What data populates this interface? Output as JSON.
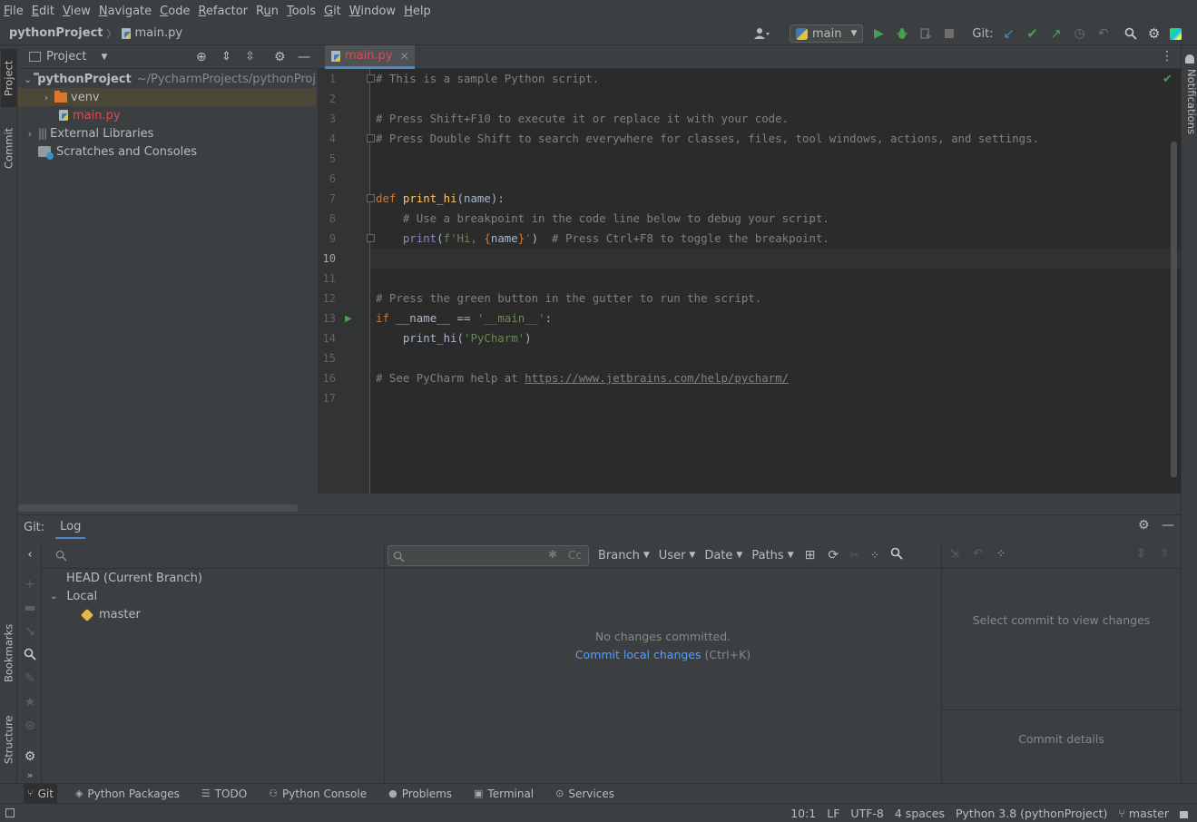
{
  "menu": {
    "items": [
      {
        "label": "File",
        "mnemonic": "F"
      },
      {
        "label": "Edit",
        "mnemonic": "E"
      },
      {
        "label": "View",
        "mnemonic": "V"
      },
      {
        "label": "Navigate",
        "mnemonic": "N"
      },
      {
        "label": "Code",
        "mnemonic": "C"
      },
      {
        "label": "Refactor",
        "mnemonic": "R"
      },
      {
        "label": "Run",
        "mnemonic": "u"
      },
      {
        "label": "Tools",
        "mnemonic": "T"
      },
      {
        "label": "Git",
        "mnemonic": "G"
      },
      {
        "label": "Window",
        "mnemonic": "W"
      },
      {
        "label": "Help",
        "mnemonic": "H"
      }
    ]
  },
  "nav": {
    "project": "pythonProject",
    "file": "main.py",
    "run_config": "main",
    "git_label": "Git:"
  },
  "left_strip": {
    "project_tab": "Project",
    "commit_tab": "Commit",
    "bookmarks_tab": "Bookmarks",
    "structure_tab": "Structure"
  },
  "right_strip": {
    "notifications_tab": "Notifications"
  },
  "project_panel": {
    "title": "Project",
    "root_name": "pythonProject",
    "root_path": "~/PycharmProjects/pythonProj",
    "venv": "venv",
    "main_file": "main.py",
    "external_libraries": "External Libraries",
    "scratches": "Scratches and Consoles"
  },
  "editor": {
    "tab_label": "main.py",
    "current_line": 10,
    "lines": [
      "# This is a sample Python script.",
      "",
      "# Press Shift+F10 to execute it or replace it with your code.",
      "# Press Double Shift to search everywhere for classes, files, tool windows, actions, and settings.",
      "",
      "",
      "def print_hi(name):",
      "    # Use a breakpoint in the code line below to debug your script.",
      "    print(f'Hi, {name}')  # Press Ctrl+F8 to toggle the breakpoint.",
      "",
      "",
      "# Press the green button in the gutter to run the script.",
      "if __name__ == '__main__':",
      "    print_hi('PyCharm')",
      "",
      "# See PyCharm help at https://www.jetbrains.com/help/pycharm/",
      ""
    ],
    "help_url": "https://www.jetbrains.com/help/pycharm/"
  },
  "git_panel": {
    "title": "Git:",
    "tab": "Log",
    "head": "HEAD (Current Branch)",
    "local": "Local",
    "branch": "master",
    "filters": [
      "Branch",
      "User",
      "Date",
      "Paths"
    ],
    "search_cc": "Cc",
    "empty_message": "No changes committed.",
    "commit_link": "Commit local changes",
    "commit_shortcut": "(Ctrl+K)",
    "select_commit": "Select commit to view changes",
    "commit_details": "Commit details"
  },
  "bottom_tabs": [
    {
      "label": "Git",
      "icon": "git-branch-icon"
    },
    {
      "label": "Python Packages",
      "icon": "packages-icon"
    },
    {
      "label": "TODO",
      "icon": "todo-list-icon"
    },
    {
      "label": "Python Console",
      "icon": "python-console-icon"
    },
    {
      "label": "Problems",
      "icon": "problems-icon"
    },
    {
      "label": "Terminal",
      "icon": "terminal-icon"
    },
    {
      "label": "Services",
      "icon": "services-icon"
    }
  ],
  "status": {
    "position": "10:1",
    "line_sep": "LF",
    "encoding": "UTF-8",
    "indent": "4 spaces",
    "interpreter": "Python 3.8 (pythonProject)",
    "branch": "master"
  },
  "colors": {
    "accent": "#4a88c7",
    "run_green": "#499c54",
    "link_blue": "#589df6",
    "file_red": "#d25252"
  }
}
